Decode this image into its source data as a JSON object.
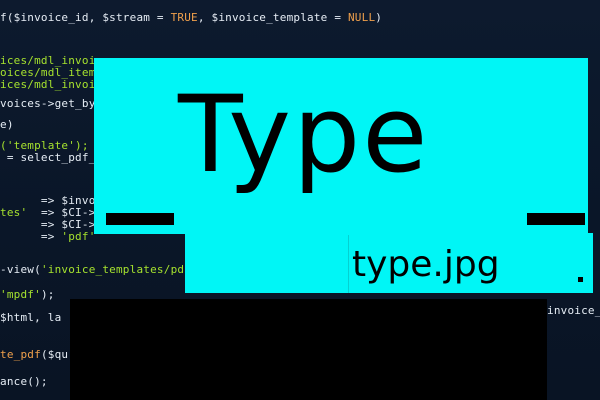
{
  "code_lines": [
    {
      "segments": [
        {
          "text": "f($invoice_id, $stream = ",
          "tone": "white"
        },
        {
          "text": "TRUE",
          "tone": "orange"
        },
        {
          "text": ", $invoice_template = ",
          "tone": "white"
        },
        {
          "text": "NULL",
          "tone": "orange"
        },
        {
          "text": ")",
          "tone": "white"
        }
      ]
    },
    {
      "segments": [
        {
          "text": "ices/mdl_invoice",
          "tone": "green"
        }
      ]
    },
    {
      "segments": [
        {
          "text": "oices/mdl_items'",
          "tone": "green"
        },
        {
          "text": ")",
          "tone": "white"
        }
      ]
    },
    {
      "segments": [
        {
          "text": "ices/mdl_invoic",
          "tone": "green"
        }
      ]
    },
    {
      "segments": [
        {
          "text": "voices->get_by_",
          "tone": "white"
        }
      ]
    },
    {
      "segments": [
        {
          "text": "e)",
          "tone": "white"
        }
      ]
    },
    {
      "segments": [
        {
          "text": "('template');",
          "tone": "green"
        }
      ]
    },
    {
      "segments": [
        {
          "text": " = select_pdf_",
          "tone": "white"
        }
      ]
    },
    {
      "segments": [
        {
          "text": "      => $invoice",
          "tone": "white"
        }
      ]
    },
    {
      "segments": [
        {
          "text": "tes'",
          "tone": "green"
        },
        {
          "text": "  => $CI->md",
          "tone": "white"
        }
      ]
    },
    {
      "segments": [
        {
          "text": "      => $CI->m",
          "tone": "white"
        }
      ]
    },
    {
      "segments": [
        {
          "text": "      => ",
          "tone": "white"
        },
        {
          "text": "'pdf'",
          "tone": "green"
        }
      ]
    },
    {
      "segments": [
        {
          "text": "-view(",
          "tone": "white"
        },
        {
          "text": "'invoice_templates/pdf",
          "tone": "green"
        }
      ]
    },
    {
      "segments": [
        {
          "text": "'mpdf'",
          "tone": "green"
        },
        {
          "text": ");",
          "tone": "white"
        }
      ]
    },
    {
      "segments": [
        {
          "text": "$html, la",
          "tone": "white"
        }
      ]
    },
    {
      "segments": [
        {
          "text": "te_pdf",
          "tone": "orange"
        },
        {
          "text": "($qu",
          "tone": "white"
        }
      ]
    },
    {
      "segments": [
        {
          "text": "ance();",
          "tone": "white"
        }
      ]
    }
  ],
  "code_right_fragment": "invoice_n",
  "hero": {
    "title": "Type",
    "subtitle": "type.jpg",
    "background_color": "#00F6F6",
    "text_color": "#000000"
  }
}
